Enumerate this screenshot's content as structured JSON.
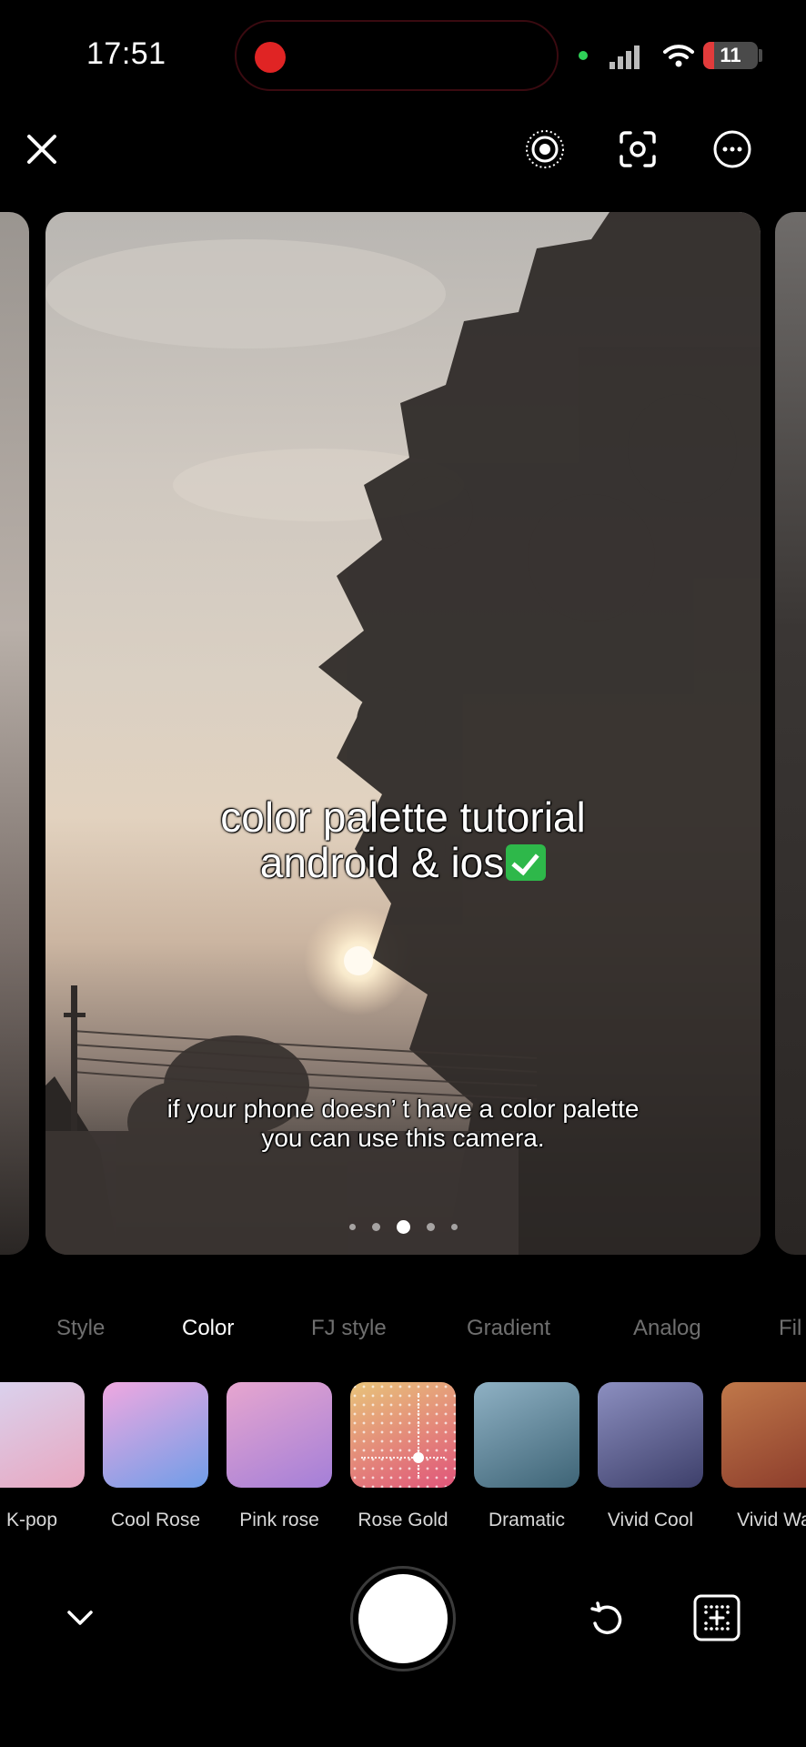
{
  "status_bar": {
    "time": "17:51",
    "battery": "11",
    "recording_color": "#e02424"
  },
  "toolbar": {
    "icons": [
      "close-icon",
      "live-photo-icon",
      "lens-switch-icon",
      "more-icon"
    ]
  },
  "preview": {
    "caption_title_line1": "color palette tutorial",
    "caption_title_line2": "android & ios",
    "caption_sub_line1": "if your phone doesn’  t have a color palette",
    "caption_sub_line2": "you can use this camera.",
    "page_count": 5,
    "active_page": 3
  },
  "tabs": [
    {
      "label": "Style",
      "active": false
    },
    {
      "label": "Color",
      "active": true
    },
    {
      "label": "FJ style",
      "active": false
    },
    {
      "label": "Gradient",
      "active": false
    },
    {
      "label": "Analog",
      "active": false
    },
    {
      "label": "Fil",
      "active": false
    }
  ],
  "filters": [
    {
      "label": "K-pop",
      "colors": [
        "#d9d4f0",
        "#e8a7c0"
      ]
    },
    {
      "label": "Cool Rose",
      "colors": [
        "#f0a8e0",
        "#6f9de8"
      ]
    },
    {
      "label": "Pink rose",
      "colors": [
        "#e7a6cf",
        "#a47fd8"
      ]
    },
    {
      "label": "Rose Gold",
      "colors": [
        "#e8c47a",
        "#e0557a"
      ],
      "selected": true
    },
    {
      "label": "Dramatic",
      "colors": [
        "#8fb1c4",
        "#3e6476"
      ]
    },
    {
      "label": "Vivid Cool",
      "colors": [
        "#8c8fc0",
        "#3d3f6a"
      ]
    },
    {
      "label": "Vivid Wa",
      "colors": [
        "#c0784a",
        "#8a3a2a"
      ]
    }
  ],
  "bottom_bar": {
    "icons": [
      "chevron-down-icon",
      "shutter-button",
      "reset-icon",
      "grid-icon"
    ]
  }
}
